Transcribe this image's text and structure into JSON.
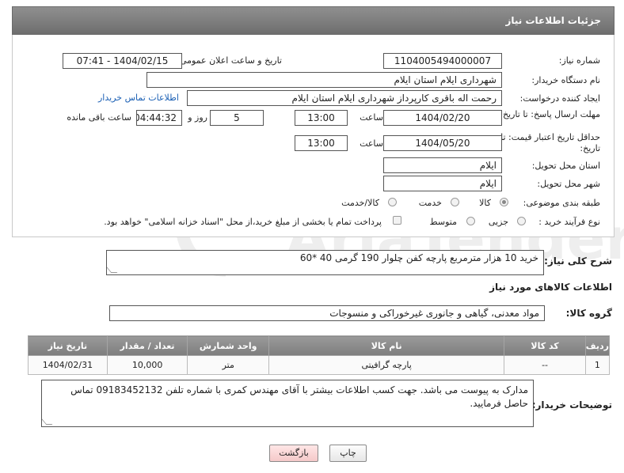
{
  "header": {
    "title": "جزئیات اطلاعات نیاز"
  },
  "form": {
    "need_number": {
      "label": "شماره نیاز:",
      "value": "1104005494000007"
    },
    "announce": {
      "label": "تاریخ و ساعت اعلان عمومی:",
      "value": "1404/02/15 - 07:41"
    },
    "buyer_org": {
      "label": "نام دستگاه خریدار:",
      "value": "شهرداری ایلام استان ایلام"
    },
    "creator": {
      "label": "ایجاد کننده درخواست:",
      "value": "رحمت اله باقری کارپرداز شهرداری ایلام استان ایلام",
      "contact_link": "اطلاعات تماس خریدار"
    },
    "reply_deadline": {
      "label": "مهلت ارسال پاسخ: تا تاریخ:",
      "date": "1404/02/20",
      "time_label": "ساعت",
      "time": "13:00",
      "days": "5",
      "days_label": "روز و",
      "remaining": "04:44:32",
      "remaining_label": "ساعت باقی مانده"
    },
    "price_validity": {
      "label": "حداقل تاریخ اعتبار قیمت: تا تاریخ:",
      "date": "1404/05/20",
      "time_label": "ساعت",
      "time": "13:00"
    },
    "delivery_province": {
      "label": "استان محل تحویل:",
      "value": "ایلام"
    },
    "delivery_city": {
      "label": "شهر محل تحویل:",
      "value": "ایلام"
    },
    "category": {
      "label": "طبقه بندی موضوعی:",
      "options": [
        "کالا",
        "خدمت",
        "کالا/خدمت"
      ],
      "selected": "کالا"
    },
    "process": {
      "label": "نوع فرآیند خرید :",
      "options": [
        "جزیی",
        "متوسط"
      ],
      "selected": "",
      "payment_note": "پرداخت تمام یا بخشی از مبلغ خرید،از محل \"اسناد خزانه اسلامی\" خواهد بود."
    }
  },
  "description": {
    "label": "شرح کلی نیاز:",
    "value": "خرید 10 هزار مترمربع پارچه کفن چلوار 190 گرمی 40 *60"
  },
  "goods_section": {
    "title": "اطلاعات کالاهای مورد نیاز",
    "group_label": "گروه کالا:",
    "group_value": "مواد معدنی، گیاهی و جانوری غیرخوراکی و منسوجات"
  },
  "table": {
    "headers": [
      "ردیف",
      "کد کالا",
      "نام کالا",
      "واحد شمارش",
      "تعداد / مقدار",
      "تاریخ نیاز"
    ],
    "rows": [
      [
        "1",
        "--",
        "پارچه گرافیتی",
        "متر",
        "10,000",
        "1404/02/31"
      ]
    ]
  },
  "buyer_notes": {
    "label": "توضیحات خریدار:",
    "value": "مدارک به پیوست می باشد. جهت کسب اطلاعات بیشتر با آقای مهندس کمری با شماره تلفن 09183452132  تماس حاصل فرمایید."
  },
  "buttons": {
    "print": "چاپ",
    "back": "بازگشت"
  },
  "colors": {
    "link": "#1a5fb4",
    "header": "#7d7d7d",
    "back_button": "#f5c9c9"
  }
}
